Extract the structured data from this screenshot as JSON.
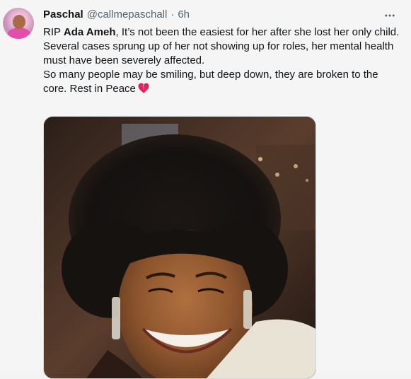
{
  "tweet": {
    "author_name": "Paschal",
    "handle": "@callmepaschall",
    "separator": "·",
    "time": "6h",
    "more_icon": "more-horizontal-icon",
    "text_prefix": "RIP ",
    "text_bold": "Ada Ameh",
    "text_line1_rest": ", It’s not been the easiest for her after she lost her only child.",
    "text_line2": "Several cases sprung up of her not showing up for roles, her mental health must have been severely affected.",
    "text_line3": "So many people may be smiling, but deep down, they are broken to the core. Rest in Peace",
    "emoji": "broken-heart-icon",
    "image": "photo of a smiling woman with a large afro hairstyle and dangling earrings"
  },
  "colors": {
    "background": "#f5f5f5",
    "text": "#0f1419",
    "secondary": "#536471",
    "heart": "#e0245e"
  }
}
